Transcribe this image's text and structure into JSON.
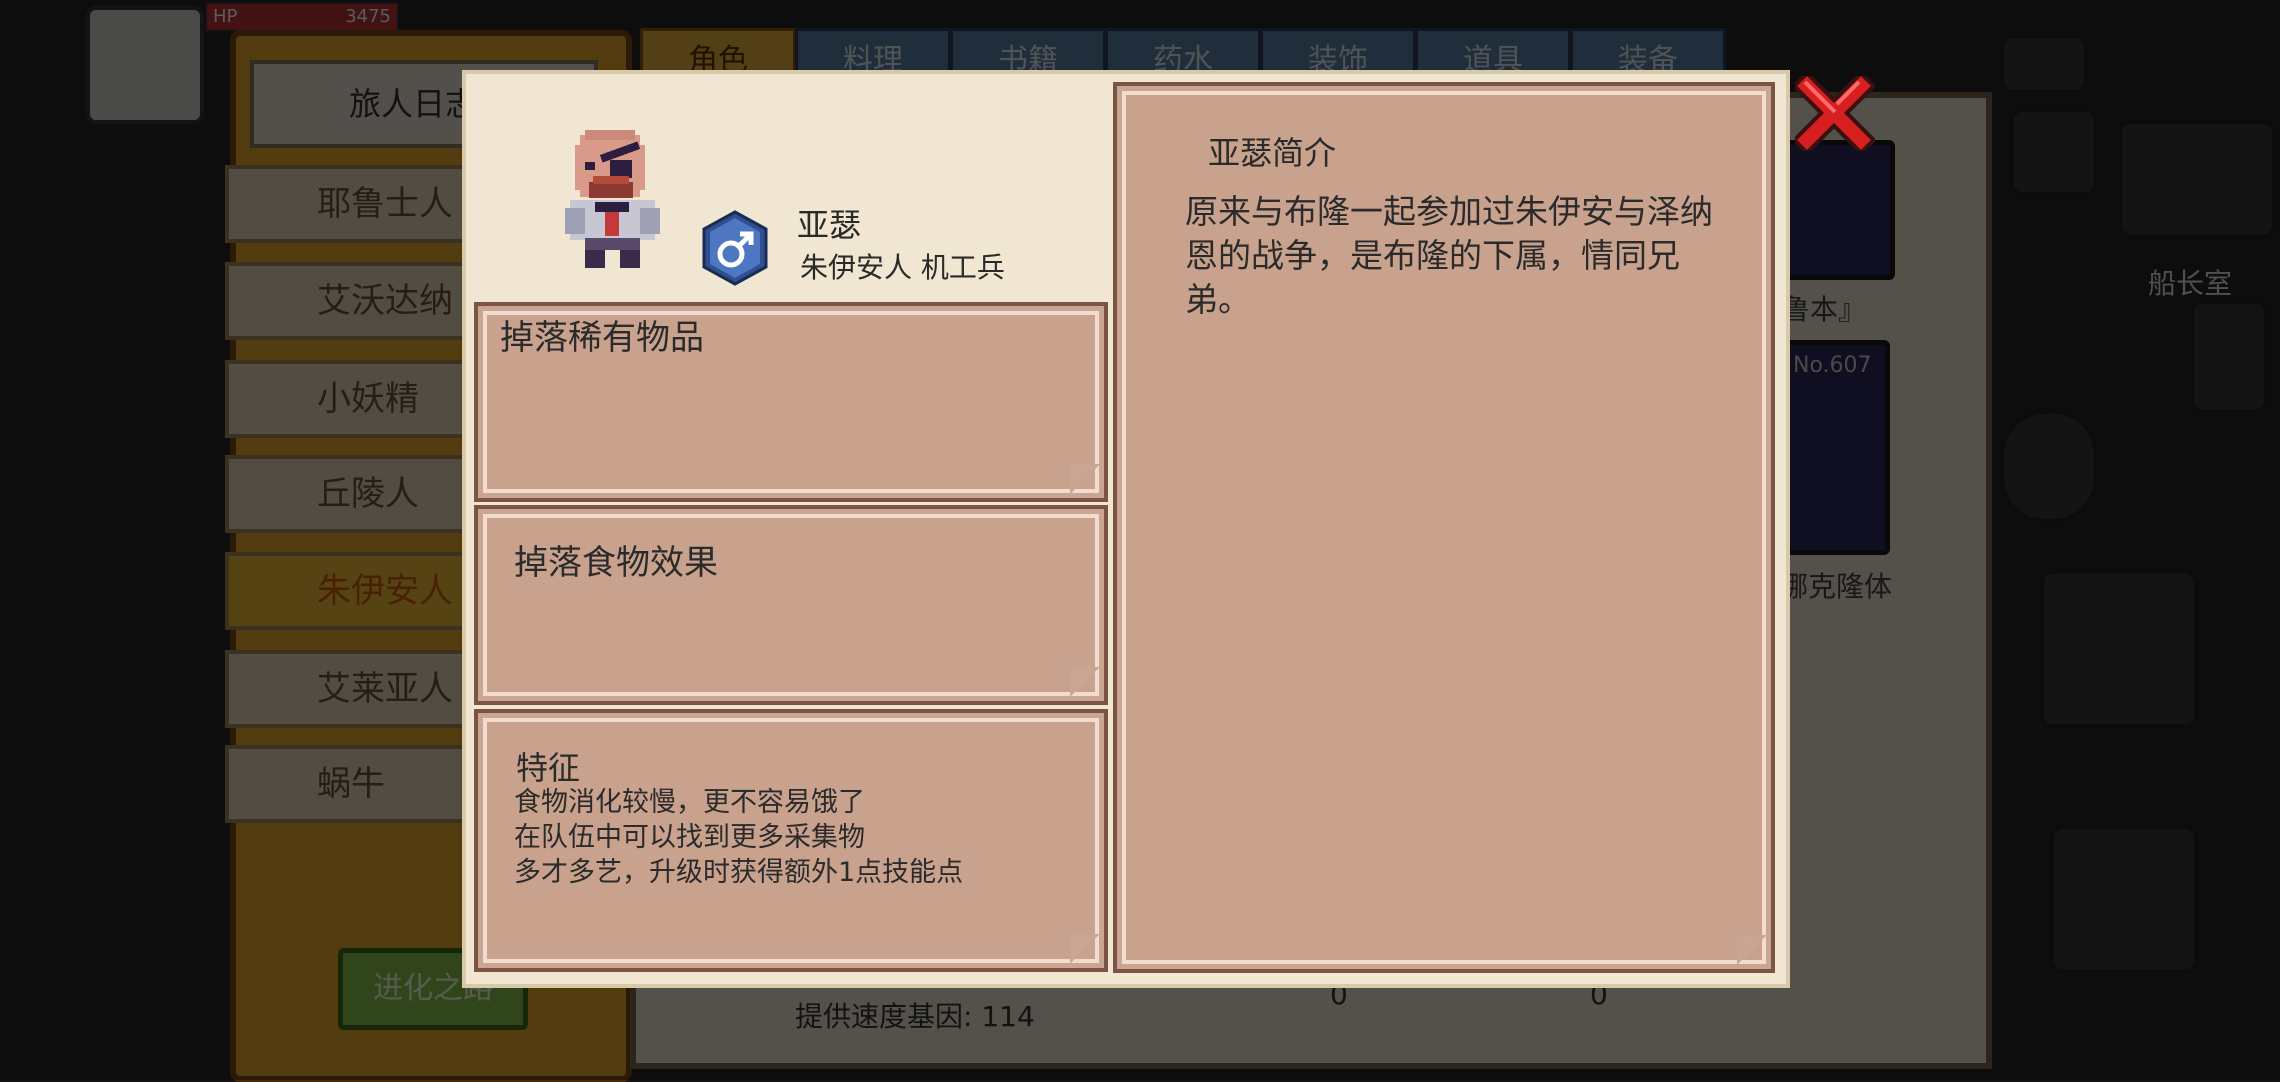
{
  "hud": {
    "hp_label": "HP",
    "hp_value": "3475"
  },
  "background": {
    "notebook_title": "旅人日志",
    "races": [
      "耶鲁士人",
      "艾沃达纳",
      "小妖精",
      "丘陵人",
      "朱伊安人",
      "艾莱亚人",
      "蜗牛"
    ],
    "selected_race_index": 4,
    "evolve_button": "进化之路",
    "tabs": [
      "角色",
      "料理",
      "书籍",
      "药水",
      "装饰",
      "道具",
      "装备"
    ],
    "side_label": "船长室",
    "card_label_1": "鲁本』",
    "card_label_2": "娜克隆体",
    "card_badge": "No.607",
    "stat_line": "提供速度基因: 114",
    "count_1": "0",
    "count_2": "0"
  },
  "modal": {
    "character_name": "亚瑟",
    "character_subtitle": "朱伊安人 机工兵",
    "gender_icon": "male-symbol",
    "rare_drops": {
      "title": "掉落稀有物品"
    },
    "food_effect": {
      "title": "掉落食物效果"
    },
    "traits": {
      "title": "特征",
      "lines": [
        "食物消化较慢，更不容易饿了",
        "在队伍中可以找到更多采集物",
        "多才多艺，升级时获得额外1点技能点"
      ]
    },
    "description": {
      "title": "亚瑟简介",
      "body": "原来与布隆一起参加过朱伊安与泽纳恩的战争，是布隆的下属，情同兄弟。"
    }
  },
  "colors": {
    "panel_bg": "#f0e6d2",
    "box_bg": "#c9a28e",
    "close_red": "#d81f1f",
    "selected_tab": "#e9b13c"
  }
}
